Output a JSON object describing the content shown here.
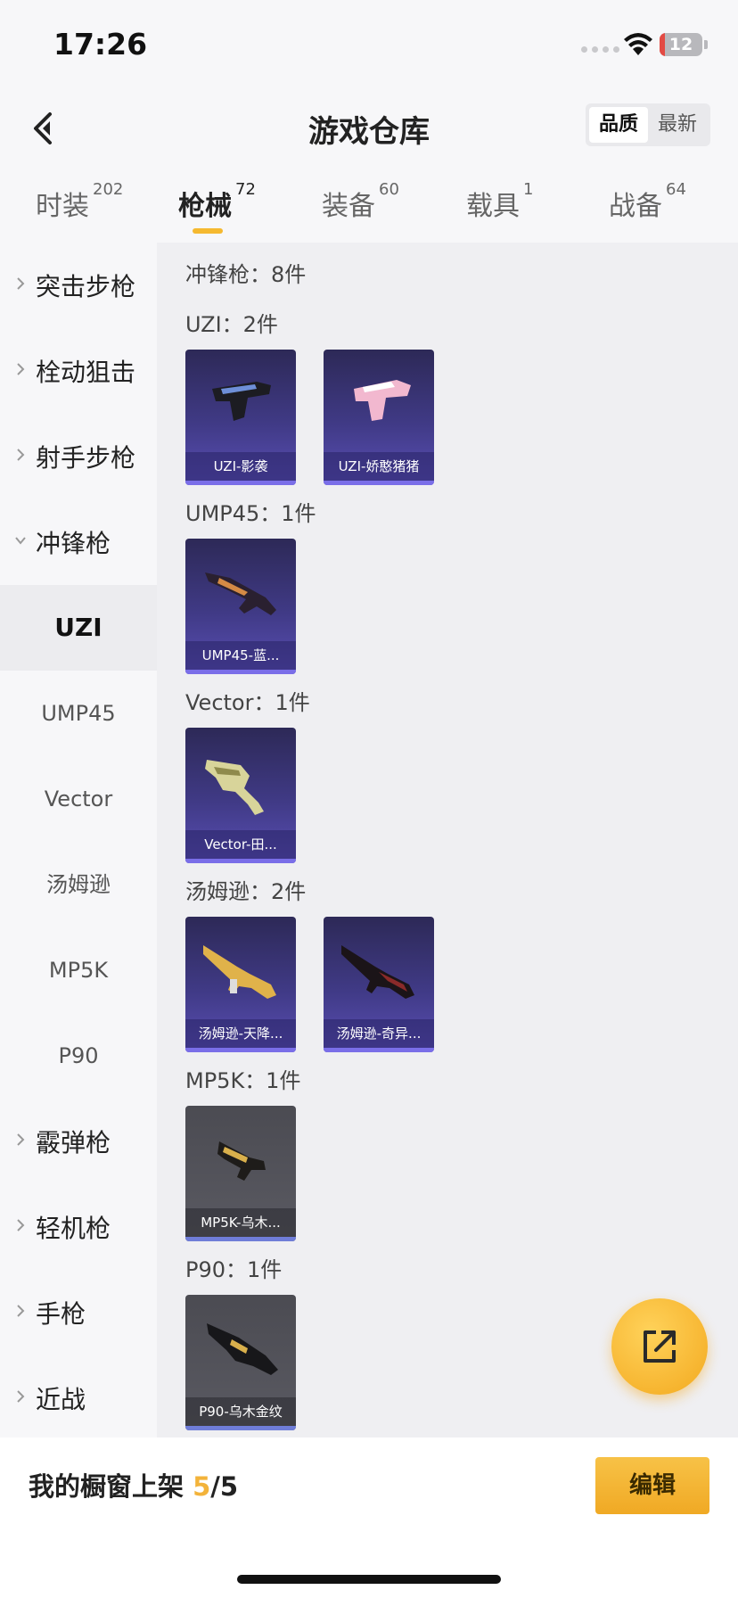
{
  "status_bar": {
    "time": "17:26",
    "battery": "12",
    "battery_level": 0.12
  },
  "header": {
    "title": "游戏仓库",
    "sort_options": [
      "品质",
      "最新"
    ],
    "sort_selected": "品质"
  },
  "tabs": [
    {
      "label": "时装",
      "count": "202"
    },
    {
      "label": "枪械",
      "count": "72",
      "active": true
    },
    {
      "label": "装备",
      "count": "60"
    },
    {
      "label": "载具",
      "count": "1"
    },
    {
      "label": "战备",
      "count": "64"
    }
  ],
  "sidebar": {
    "categories": [
      "突击步枪",
      "栓动狙击",
      "射手步枪",
      "冲锋枪",
      "霰弹枪",
      "轻机枪",
      "手枪",
      "近战"
    ],
    "subcategories": [
      "UZI",
      "UMP45",
      "Vector",
      "汤姆逊",
      "MP5K",
      "P90"
    ],
    "active_sub": "UZI"
  },
  "content": {
    "category_header": "冲锋枪：8件",
    "groups": [
      {
        "title": "UZI：2件",
        "items": [
          {
            "name": "UZI-影袭",
            "style": "purple",
            "icon": "uzi-gun-icon"
          },
          {
            "name": "UZI-娇憨猪猪",
            "style": "purple",
            "icon": "uzi-pink-gun-icon"
          }
        ]
      },
      {
        "title": "UMP45：1件",
        "items": [
          {
            "name": "UMP45-蓝...",
            "style": "purple",
            "icon": "ump45-gun-icon"
          }
        ]
      },
      {
        "title": "Vector：1件",
        "items": [
          {
            "name": "Vector-田...",
            "style": "purple",
            "icon": "vector-gun-icon"
          }
        ]
      },
      {
        "title": "汤姆逊：2件",
        "items": [
          {
            "name": "汤姆逊-天降...",
            "style": "purple",
            "icon": "thompson-gold-gun-icon"
          },
          {
            "name": "汤姆逊-奇异...",
            "style": "purple",
            "icon": "thompson-dark-gun-icon"
          }
        ]
      },
      {
        "title": "MP5K：1件",
        "items": [
          {
            "name": "MP5K-乌木...",
            "style": "gray",
            "icon": "mp5k-gun-icon"
          }
        ]
      },
      {
        "title": "P90：1件",
        "items": [
          {
            "name": "P90-乌木金纹",
            "style": "gray",
            "icon": "p90-gun-icon"
          }
        ]
      }
    ]
  },
  "bottom": {
    "label": "我的橱窗上架 ",
    "count": "5",
    "total": "/5",
    "edit_label": "编辑"
  },
  "colors": {
    "accent": "#f3b33a",
    "purple_card": "#403a86",
    "gray_card": "#55555c"
  }
}
